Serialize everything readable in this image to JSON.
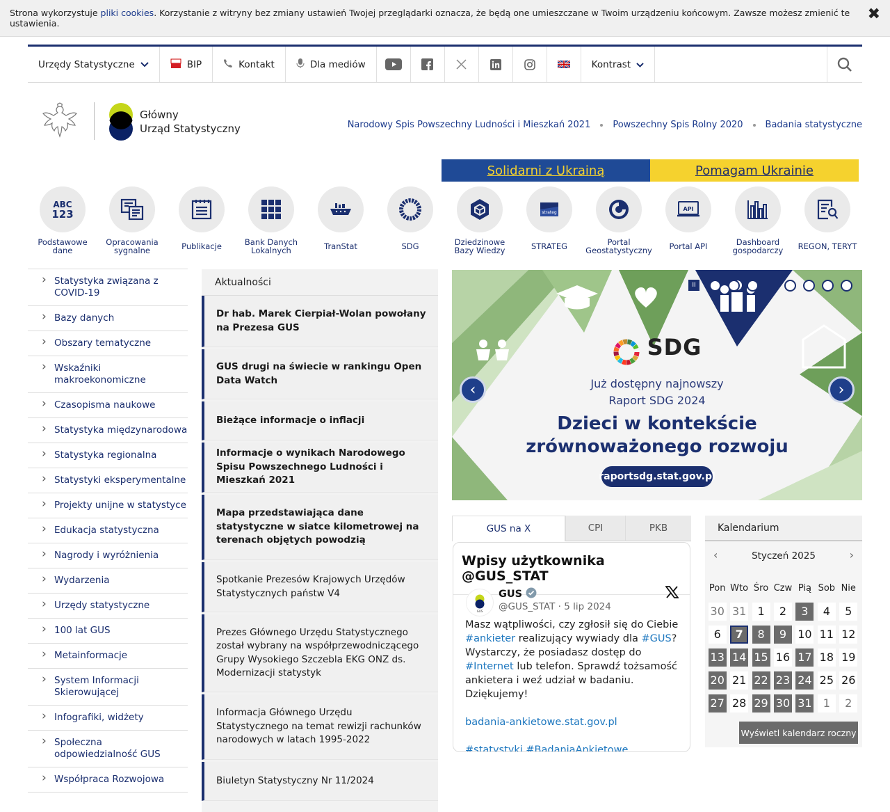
{
  "cookie": {
    "text_before": "Strona wykorzystuje ",
    "link": "pliki cookies",
    "text_after": ". Korzystanie z witryny bez zmiany ustawień Twojej przeglądarki oznacza, że będą one umieszczane w Twoim urządzeniu końcowym. Zawsze możesz zmienić te ustawienia.",
    "close": "✖"
  },
  "topbar": {
    "offices": "Urzędy Statystyczne",
    "bip": "BIP",
    "contact": "Kontakt",
    "media": "Dla mediów",
    "contrast": "Kontrast"
  },
  "logo": {
    "line1": "Główny",
    "line2": "Urząd Statystyczny"
  },
  "census": [
    "Narodowy Spis Powszechny Ludności i Mieszkań 2021",
    "Powszechny Spis Rolny 2020",
    "Badania statystyczne"
  ],
  "ukraine": {
    "left": "Solidarni z Ukrainą",
    "right": "Pomagam Ukrainie"
  },
  "icons": [
    {
      "label": "Podstawowe\ndane",
      "glyph": "ABC\n123"
    },
    {
      "label": "Opracowania\nsygnalne"
    },
    {
      "label": "Publikacje"
    },
    {
      "label": "Bank Danych\nLokalnych"
    },
    {
      "label": "TranStat"
    },
    {
      "label": "SDG"
    },
    {
      "label": "Dziedzinowe\nBazy Wiedzy"
    },
    {
      "label": "STRATEG",
      "glyph": "strateg"
    },
    {
      "label": "Portal\nGeostatystyczny"
    },
    {
      "label": "Portal API",
      "glyph": "API"
    },
    {
      "label": "Dashboard\ngospodarczy"
    },
    {
      "label": "REGON, TERYT"
    }
  ],
  "sidebar": [
    "Statystyka związana z COVID-19",
    "Bazy danych",
    "Obszary tematyczne",
    "Wskaźniki makroekonomiczne",
    "Czasopisma naukowe",
    "Statystyka międzynarodowa",
    "Statystyka regionalna",
    "Statystyki eksperymentalne",
    "Projekty unijne w statystyce",
    "Edukacja statystyczna",
    "Nagrody i wyróżnienia",
    "Wydarzenia",
    "Urzędy statystyczne",
    "100 lat GUS",
    "Metainformacje",
    "System Informacji Skierowującej",
    "Infografiki, widżety",
    "Społeczna odpowiedzialność GUS",
    "Współpraca Rozwojowa"
  ],
  "news": {
    "title": "Aktualności",
    "items": [
      {
        "text": "Dr hab. Marek Cierpiał-Wolan powołany na Prezesa GUS",
        "bold": true,
        "h": 74
      },
      {
        "text": "GUS drugi na świecie w rankingu Open Data Watch",
        "bold": true,
        "h": 72
      },
      {
        "text": "Bieżące informacje o inflacji",
        "bold": true,
        "h": 56
      },
      {
        "text": "Informacje o wynikach Narodowego Spisu Powszechnego Ludności i Mieszkań 2021",
        "bold": true,
        "h": 72
      },
      {
        "text": "Mapa przedstawiająca dane statystyczne w siatce kilometrowej na terenach objętych powodzią",
        "bold": true,
        "h": 94
      },
      {
        "text": "Spotkanie Prezesów Krajowych Urzędów Statystycznych państw V4",
        "bold": false,
        "h": 72
      },
      {
        "text": "Prezes Głównego Urzędu Statystycznego został wybrany na współprzewodniczącego Grupy Wysokiego Szczebla EKG ONZ ds. Modernizacji statystyk",
        "bold": false,
        "h": 112
      },
      {
        "text": "Informacja Głównego Urzędu Statystycznego na temat rewizji rachunków narodowych w latach 1995-2022",
        "bold": false,
        "h": 94
      },
      {
        "text": "Biuletyn Statystyczny Nr 11/2024",
        "bold": false,
        "h": 56
      }
    ]
  },
  "slider": {
    "pause": "II",
    "sdg": "SDG",
    "line1": "Już dostępny najnowszy",
    "line2": "Raport SDG 2024",
    "headline1": "Dzieci w kontekście",
    "headline2": "zrównoważonego rozwoju",
    "url": "raportsdg.stat.gov.pl",
    "prev": "‹",
    "next": "›"
  },
  "tabs": [
    "GUS na X",
    "CPI",
    "PKB"
  ],
  "xfeed": {
    "header": "Wpisy użytkownika @GUS_STAT",
    "name": "GUS",
    "handle": "@GUS_STAT · 5 lip 2024",
    "text1": "Masz wątpliwości, czy zgłosił się do Ciebie ",
    "tag1": "#ankieter",
    "text2": " realizujący wywiady dla ",
    "tag2": "#GUS",
    "text3": "? Wystarczy, że posiadasz dostęp do ",
    "tag3": "#Internet",
    "text4": " lub telefon. Sprawdź tożsamość ankietera i weź udział w badaniu. Dziękujemy!",
    "link": "badania-ankietowe.stat.gov.pl",
    "tags": "#statystyki #BadaniaAnkietowe",
    "avatar": "GUS"
  },
  "calendar": {
    "title": "Kalendarium",
    "month": "Styczeń 2025",
    "weekdays": [
      "Pon",
      "Wto",
      "Śro",
      "Czw",
      "Pią",
      "Sob",
      "Nie"
    ],
    "weeks": [
      [
        [
          "30",
          "out"
        ],
        [
          "31",
          "out"
        ],
        [
          "1",
          "w"
        ],
        [
          "2",
          "w"
        ],
        [
          "3",
          "gr"
        ],
        [
          "4",
          "w"
        ],
        [
          "5",
          "w"
        ]
      ],
      [
        [
          "6",
          "w"
        ],
        [
          "7",
          "today"
        ],
        [
          "8",
          "gr"
        ],
        [
          "9",
          "gr"
        ],
        [
          "10",
          "w"
        ],
        [
          "11",
          "w"
        ],
        [
          "12",
          "w"
        ]
      ],
      [
        [
          "13",
          "gr"
        ],
        [
          "14",
          "gr"
        ],
        [
          "15",
          "gr"
        ],
        [
          "16",
          "w"
        ],
        [
          "17",
          "gr"
        ],
        [
          "18",
          "w"
        ],
        [
          "19",
          "w"
        ]
      ],
      [
        [
          "20",
          "gr"
        ],
        [
          "21",
          "w"
        ],
        [
          "22",
          "gr"
        ],
        [
          "23",
          "gr"
        ],
        [
          "24",
          "gr"
        ],
        [
          "25",
          "w"
        ],
        [
          "26",
          "w"
        ]
      ],
      [
        [
          "27",
          "gr"
        ],
        [
          "28",
          "w"
        ],
        [
          "29",
          "gr"
        ],
        [
          "30",
          "gr"
        ],
        [
          "31",
          "gr"
        ],
        [
          "1",
          "out"
        ],
        [
          "2",
          "out"
        ]
      ]
    ],
    "button": "Wyświetl kalendarz roczny"
  }
}
